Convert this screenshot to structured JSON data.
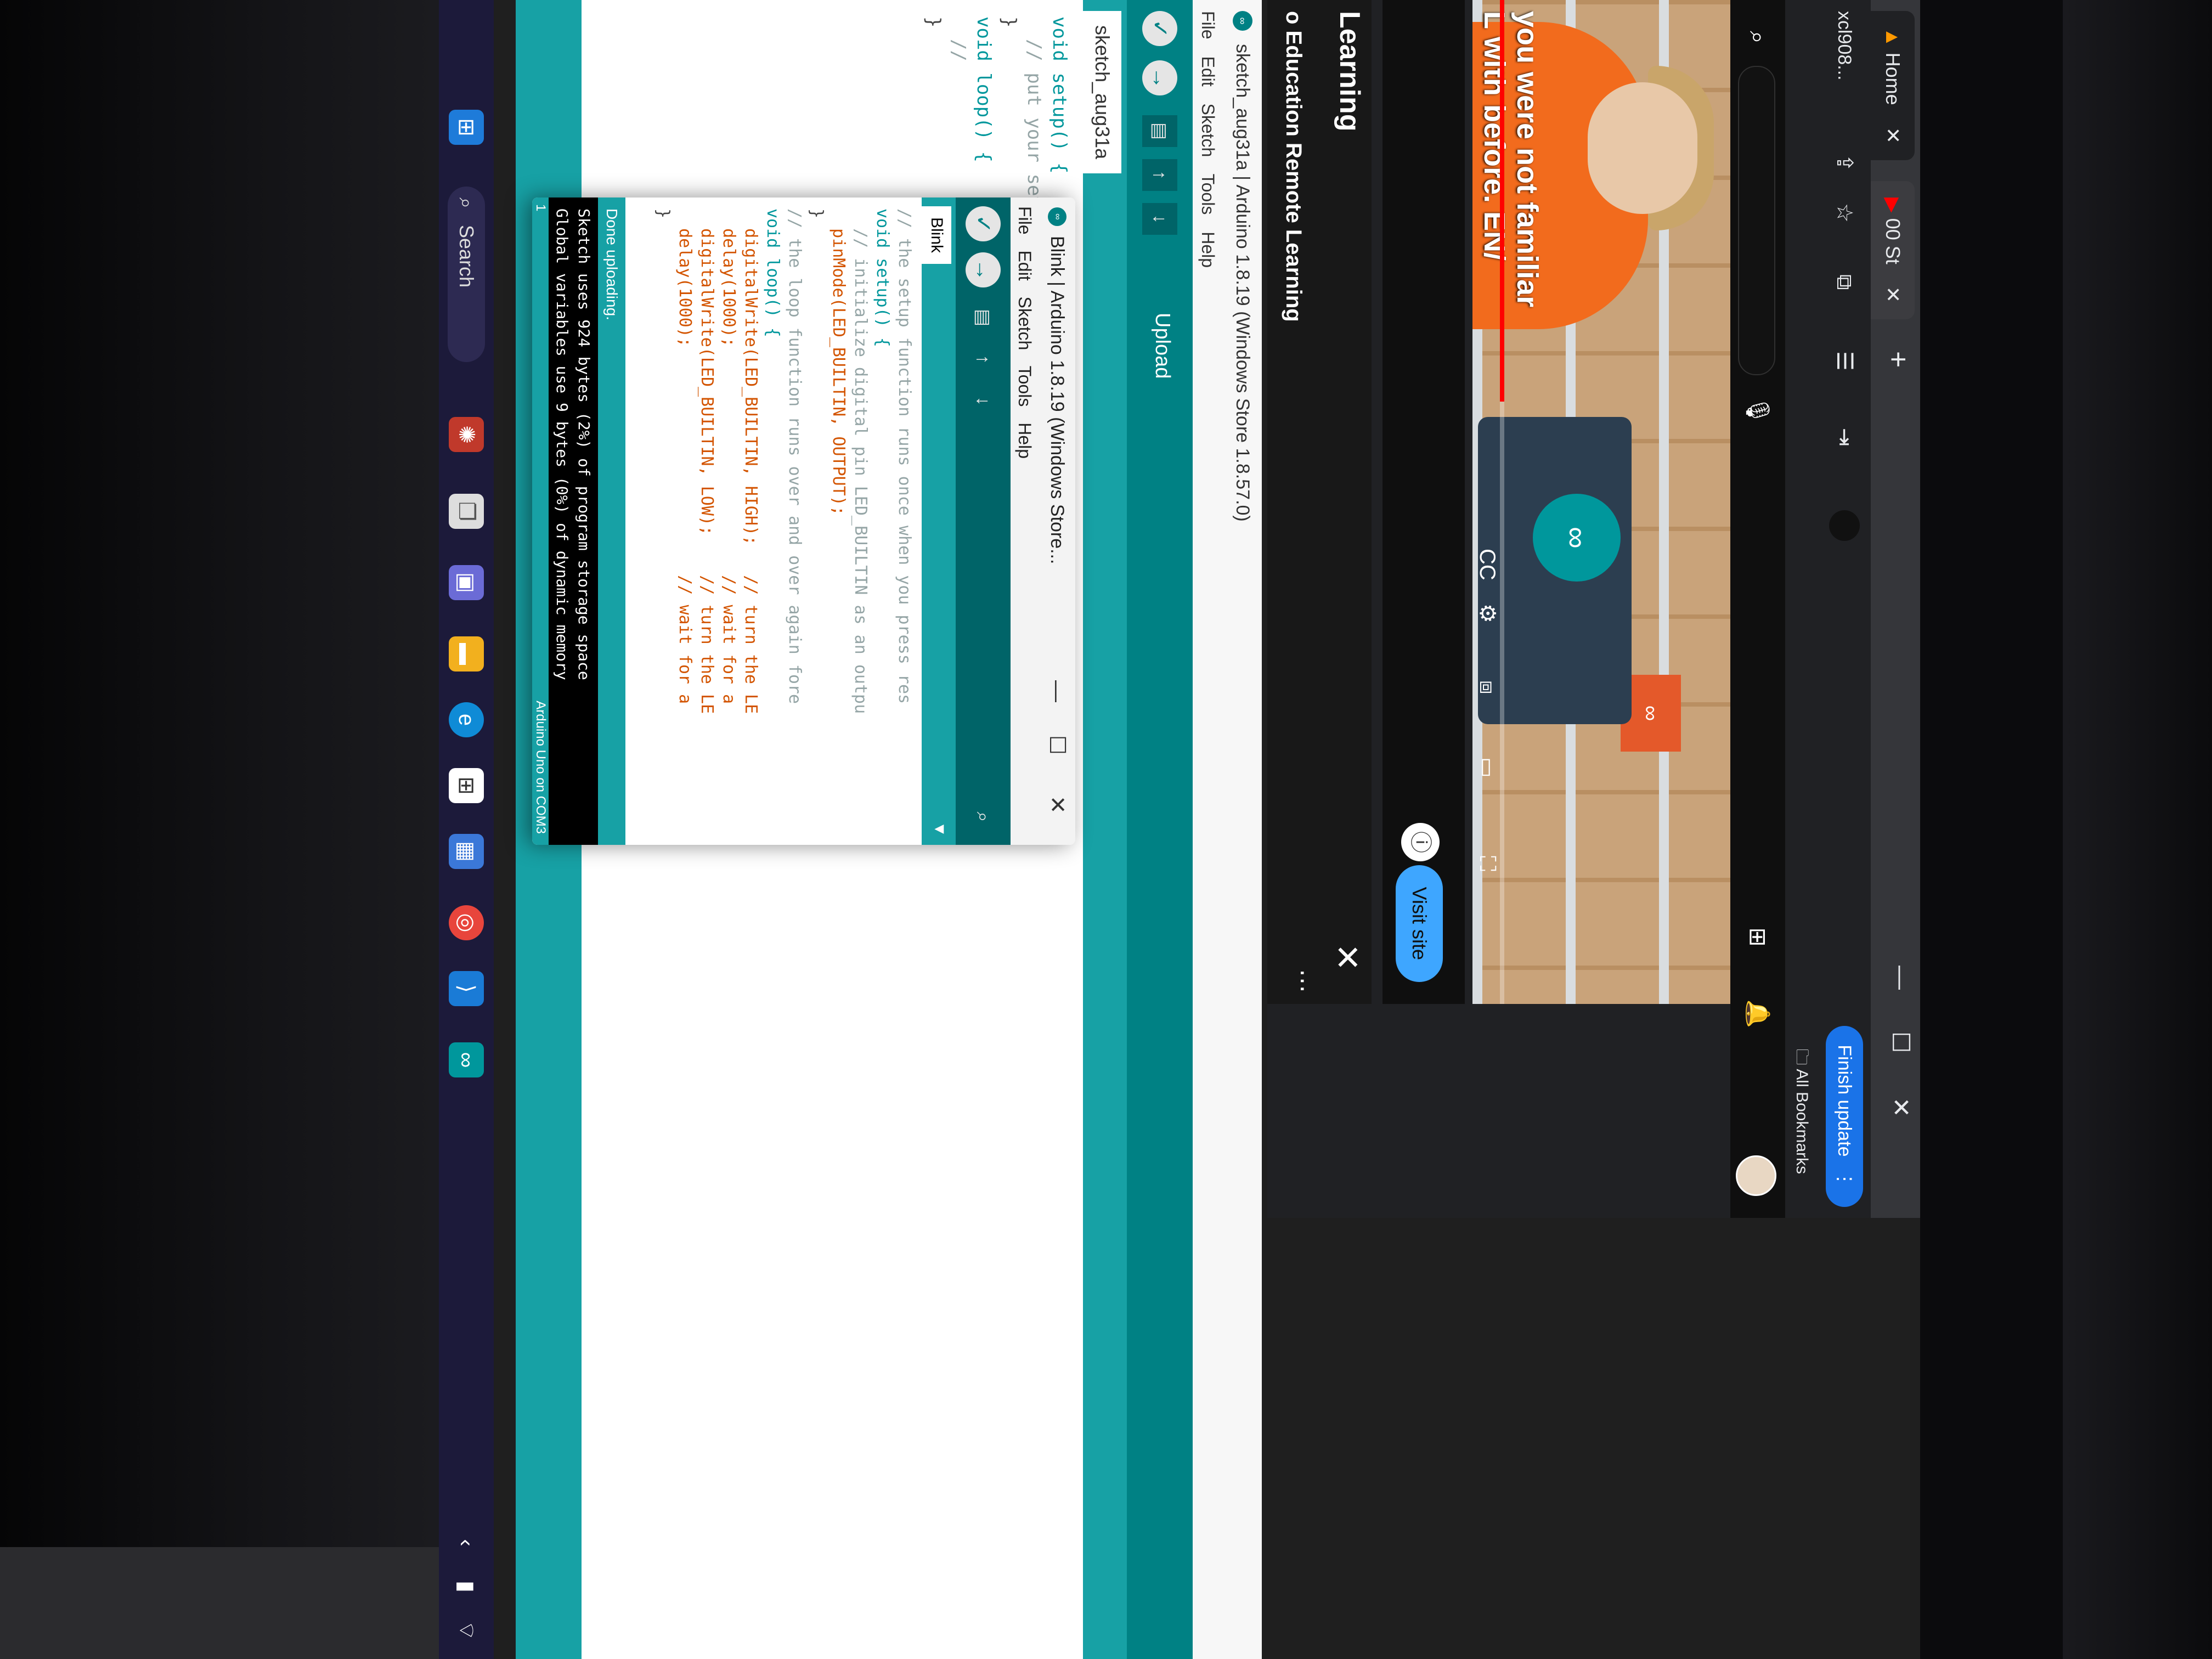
{
  "browser": {
    "tabs": [
      {
        "label": "Home"
      },
      {
        "label": "00 St"
      }
    ],
    "close_glyph": "✕",
    "new_tab_glyph": "+",
    "url_fragment": "xcl908...",
    "finish_update_label": "Finish update",
    "all_bookmarks_label": "All Bookmarks"
  },
  "youtube": {
    "caption_line1": "you were not familiar",
    "caption_line2": "L with before. EN/",
    "cc_label": "CC",
    "visit_site_label": "Visit site",
    "learning_title": "Learning",
    "learning_subtitle": "o Education Remote Learning",
    "laptop_logo_text": "ARDUINO"
  },
  "ide_main": {
    "title": "sketch_aug31a | Arduino 1.8.19 (Windows Store 1.8.57.0)",
    "menu": [
      "File",
      "Edit",
      "Sketch",
      "Tools",
      "Help"
    ],
    "upload_tooltip": "Upload",
    "tab_label": "sketch_aug31a",
    "code_lines": [
      "void setup() {",
      "  // put your setup code here, to run once:",
      "",
      "}",
      "",
      "void loop() {",
      "  //",
      "}"
    ]
  },
  "ide_blink": {
    "title": "Blink | Arduino 1.8.19 (Windows Store...",
    "menu": [
      "File",
      "Edit",
      "Sketch",
      "Tools",
      "Help"
    ],
    "tab_label": "Blink",
    "code_lines": [
      "// the setup function runs once when you press res",
      "void setup() {",
      "  // initialize digital pin LED_BUILTIN as an outpu",
      "  pinMode(LED_BUILTIN, OUTPUT);",
      "}",
      "",
      "// the loop function runs over and over again fore",
      "void loop() {",
      "  digitalWrite(LED_BUILTIN, HIGH);   // turn the LE",
      "  delay(1000);                       // wait for a",
      "  digitalWrite(LED_BUILTIN, LOW);    // turn the LE",
      "  delay(1000);                       // wait for a",
      "}"
    ],
    "status": "Done uploading.",
    "console_line1": "Sketch uses 924 bytes (2%) of program storage space",
    "console_line2": "Global variables use 9 bytes (0%) of dynamic memory",
    "line_number": "1",
    "board_port": "Arduino Uno on COM3"
  },
  "taskbar": {
    "search_label": "Search",
    "icons": [
      "windows-start-icon",
      "search-icon",
      "copilot-icon",
      "file-explorer-icon",
      "edge-icon",
      "microsoft-store-icon",
      "calendar-icon",
      "chrome-icon",
      "vscode-icon",
      "arduino-icon"
    ]
  },
  "colors": {
    "arduino_teal": "#00979C",
    "arduino_dark_teal": "#006468",
    "youtube_blue": "#3EA6FF",
    "chrome_update_blue": "#1A73E8",
    "taskbar_bg": "#1C1A3A"
  }
}
